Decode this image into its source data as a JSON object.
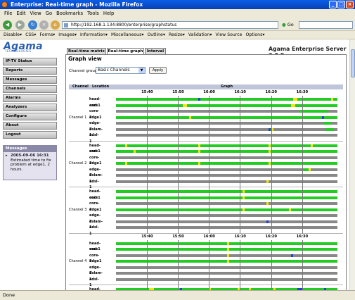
{
  "window": {
    "title": "Enterprise: Real-time graph - Mozilla Firefox"
  },
  "menu": [
    "File",
    "Edit",
    "View",
    "Go",
    "Bookmarks",
    "Tools",
    "Help"
  ],
  "nav": {
    "url": "http://192.168.1.134:8800/enterprise/graphstatus",
    "go_label": "Go"
  },
  "webdev": [
    "Disable▾",
    "CSS▾",
    "Forms▾",
    "Images▾",
    "Information▾",
    "Miscellaneous▾",
    "Outline▾",
    "Resize▾",
    "Validation▾",
    "View Source",
    "Options▾"
  ],
  "status": "Done",
  "logo": {
    "name": "Agama",
    "sub": "TECHNOLOGIES"
  },
  "server": "Agama Enterprise Server 2.2.0",
  "sidebar": [
    "IP-TV Status",
    "Reports",
    "Messages",
    "Channels",
    "Alarms",
    "Analyzers",
    "Configure",
    "About",
    "Logout"
  ],
  "messages": {
    "title": "Messages",
    "time": "2005-09-06 16:31",
    "text": "Estimated time to fix problem at edge1, 2 hours."
  },
  "tabs": [
    "Real-time matrix",
    "Real-time graph",
    "Interval"
  ],
  "graph": {
    "title": "Graph view",
    "channel_group_label": "Channel group:",
    "channel_group_value": "Basic Channels",
    "apply_label": "Apply",
    "headers": {
      "channel": "Channel",
      "location": "Location",
      "graph": "Graph"
    },
    "ticks": [
      "15:40",
      "15:50",
      "16:00",
      "16:10",
      "16:20",
      "16:30"
    ],
    "colors": {
      "ok": "#22cc22",
      "warn": "#f2e600",
      "error": "#2040d0",
      "nodata": "#888888"
    },
    "groups": [
      {
        "name": "Channel 1",
        "show_ticks": true,
        "rows": [
          {
            "label": "head-end",
            "segments": [
              {
                "s": 0.37,
                "e": 0.38,
                "st": "error"
              },
              {
                "s": 0.8,
                "e": 0.82,
                "st": "warn"
              },
              {
                "s": 0.97,
                "e": 0.98,
                "st": "warn"
              }
            ]
          },
          {
            "label": "core1",
            "segments": [
              {
                "s": 0.3,
                "e": 0.32,
                "st": "warn"
              },
              {
                "s": 0.79,
                "e": 0.81,
                "st": "warn"
              }
            ]
          },
          {
            "label": "core-2",
            "segments": [
              {
                "s": 0.0,
                "e": 0.83,
                "st": "nodata"
              },
              {
                "s": 0.96,
                "e": 1.0,
                "st": "nodata"
              }
            ]
          },
          {
            "label": "edge1",
            "segments": [
              {
                "s": 0.33,
                "e": 0.34,
                "st": "warn"
              },
              {
                "s": 0.93,
                "e": 0.94,
                "st": "error"
              }
            ]
          },
          {
            "label": "edge-2",
            "segments": [
              {
                "s": 0.0,
                "e": 0.94,
                "st": "nodata"
              },
              {
                "s": 0.97,
                "e": 1.0,
                "st": "nodata"
              }
            ]
          },
          {
            "label": "dslam-1",
            "segments": [
              {
                "s": 0.0,
                "e": 0.69,
                "st": "nodata"
              },
              {
                "s": 0.69,
                "e": 0.7,
                "st": "error"
              },
              {
                "s": 0.7,
                "e": 0.71,
                "st": "warn"
              },
              {
                "s": 0.71,
                "e": 0.95,
                "st": "nodata"
              },
              {
                "s": 0.98,
                "e": 1.0,
                "st": "nodata"
              }
            ]
          },
          {
            "label": "adsl-1",
            "segments": [
              {
                "s": 0.0,
                "e": 1.0,
                "st": "nodata"
              }
            ]
          }
        ]
      },
      {
        "name": "Channel 2",
        "show_ticks": false,
        "rows": [
          {
            "label": "head-end",
            "segments": [
              {
                "s": 0.04,
                "e": 0.05,
                "st": "warn"
              },
              {
                "s": 0.37,
                "e": 0.38,
                "st": "warn"
              },
              {
                "s": 0.69,
                "e": 0.7,
                "st": "warn"
              },
              {
                "s": 0.88,
                "e": 0.89,
                "st": "warn"
              }
            ]
          },
          {
            "label": "core1",
            "segments": [
              {
                "s": 0.08,
                "e": 0.09,
                "st": "warn"
              },
              {
                "s": 0.37,
                "e": 0.38,
                "st": "warn"
              },
              {
                "s": 0.69,
                "e": 0.7,
                "st": "warn"
              }
            ]
          },
          {
            "label": "core-2",
            "segments": [
              {
                "s": 0.0,
                "e": 1.0,
                "st": "nodata"
              }
            ]
          },
          {
            "label": "edge1",
            "segments": [
              {
                "s": 0.04,
                "e": 0.05,
                "st": "warn"
              },
              {
                "s": 0.37,
                "e": 0.38,
                "st": "warn"
              },
              {
                "s": 0.69,
                "e": 0.7,
                "st": "warn"
              }
            ]
          },
          {
            "label": "edge-2",
            "segments": [
              {
                "s": 0.0,
                "e": 0.84,
                "st": "nodata"
              },
              {
                "s": 0.87,
                "e": 0.88,
                "st": "warn"
              },
              {
                "s": 0.88,
                "e": 1.0,
                "st": "nodata"
              }
            ]
          },
          {
            "label": "dslam-1",
            "segments": [
              {
                "s": 0.0,
                "e": 1.0,
                "st": "nodata"
              }
            ]
          },
          {
            "label": "adsl-1",
            "segments": [
              {
                "s": 0.0,
                "e": 0.68,
                "st": "nodata"
              },
              {
                "s": 0.68,
                "e": 0.69,
                "st": "warn"
              },
              {
                "s": 0.69,
                "e": 1.0,
                "st": "nodata"
              }
            ]
          }
        ]
      },
      {
        "name": "Channel 3",
        "show_ticks": false,
        "rows": [
          {
            "label": "head-end",
            "segments": [
              {
                "s": 0.57,
                "e": 0.58,
                "st": "warn"
              }
            ]
          },
          {
            "label": "core1",
            "segments": [
              {
                "s": 0.57,
                "e": 0.58,
                "st": "warn"
              }
            ]
          },
          {
            "label": "core-2",
            "segments": [
              {
                "s": 0.0,
                "e": 0.68,
                "st": "nodata"
              },
              {
                "s": 0.68,
                "e": 0.69,
                "st": "warn"
              },
              {
                "s": 0.69,
                "e": 1.0,
                "st": "nodata"
              }
            ]
          },
          {
            "label": "edge1",
            "segments": [
              {
                "s": 0.57,
                "e": 0.58,
                "st": "warn"
              },
              {
                "s": 0.78,
                "e": 0.79,
                "st": "warn"
              }
            ]
          },
          {
            "label": "edge-2",
            "segments": [
              {
                "s": 0.0,
                "e": 1.0,
                "st": "nodata"
              }
            ]
          },
          {
            "label": "dslam-1",
            "segments": [
              {
                "s": 0.0,
                "e": 0.68,
                "st": "nodata"
              },
              {
                "s": 0.68,
                "e": 0.69,
                "st": "error"
              },
              {
                "s": 0.69,
                "e": 1.0,
                "st": "nodata"
              }
            ]
          },
          {
            "label": "adsl-1",
            "segments": [
              {
                "s": 0.0,
                "e": 1.0,
                "st": "nodata"
              }
            ]
          }
        ]
      },
      {
        "name": "Channel 4",
        "show_ticks": true,
        "rows": [
          {
            "label": "head-end",
            "segments": [
              {
                "s": 0.5,
                "e": 0.51,
                "st": "warn"
              }
            ]
          },
          {
            "label": "core1",
            "segments": [
              {
                "s": 0.5,
                "e": 0.51,
                "st": "warn"
              }
            ]
          },
          {
            "label": "core-2",
            "segments": [
              {
                "s": 0.0,
                "e": 0.5,
                "st": "nodata"
              },
              {
                "s": 0.5,
                "e": 0.51,
                "st": "warn"
              },
              {
                "s": 0.51,
                "e": 0.79,
                "st": "nodata"
              },
              {
                "s": 0.79,
                "e": 0.8,
                "st": "error"
              },
              {
                "s": 0.8,
                "e": 1.0,
                "st": "nodata"
              }
            ]
          },
          {
            "label": "edge1",
            "segments": [
              {
                "s": 0.5,
                "e": 0.51,
                "st": "warn"
              }
            ]
          },
          {
            "label": "edge-2",
            "segments": [
              {
                "s": 0.0,
                "e": 1.0,
                "st": "nodata"
              }
            ]
          },
          {
            "label": "dslam-1",
            "segments": [
              {
                "s": 0.0,
                "e": 1.0,
                "st": "nodata"
              }
            ]
          },
          {
            "label": "adsl-1",
            "segments": [
              {
                "s": 0.0,
                "e": 1.0,
                "st": "nodata"
              }
            ]
          }
        ]
      },
      {
        "name": "",
        "show_ticks": false,
        "rows": [
          {
            "label": "head-end",
            "segments": [
              {
                "s": 0.15,
                "e": 0.17,
                "st": "warn"
              },
              {
                "s": 0.29,
                "e": 0.3,
                "st": "error"
              },
              {
                "s": 0.42,
                "e": 0.43,
                "st": "warn"
              },
              {
                "s": 0.55,
                "e": 0.56,
                "st": "warn"
              },
              {
                "s": 0.6,
                "e": 0.61,
                "st": "warn"
              },
              {
                "s": 0.71,
                "e": 0.72,
                "st": "warn"
              },
              {
                "s": 0.82,
                "e": 0.84,
                "st": "error"
              },
              {
                "s": 0.94,
                "e": 0.95,
                "st": "error"
              }
            ]
          },
          {
            "label": "core1",
            "segments": [
              {
                "s": 0.15,
                "e": 0.17,
                "st": "warn"
              },
              {
                "s": 0.29,
                "e": 0.3,
                "st": "error"
              },
              {
                "s": 0.42,
                "e": 0.43,
                "st": "warn"
              },
              {
                "s": 0.55,
                "e": 0.56,
                "st": "warn"
              },
              {
                "s": 0.6,
                "e": 0.61,
                "st": "warn"
              },
              {
                "s": 0.71,
                "e": 0.72,
                "st": "warn"
              },
              {
                "s": 0.82,
                "e": 0.84,
                "st": "error"
              }
            ]
          }
        ]
      }
    ]
  }
}
